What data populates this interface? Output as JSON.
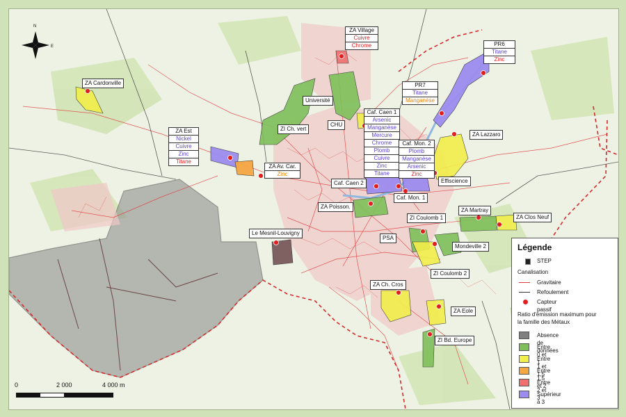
{
  "scale": {
    "t0": "0",
    "t1": "2 000",
    "t2": "4 000 m"
  },
  "compass": {
    "n": "N",
    "e": "E"
  },
  "labels": {
    "za_cardonville": "ZA Cardonville",
    "universite": "Université",
    "zi_ch_vert": "ZI Ch. vert",
    "chu": "CHU",
    "za_lazzaro": "ZA Lazzaro",
    "effiscience": "Effiscience",
    "caf_caen2": "Caf. Caen 2",
    "caf_mon1": "Caf. Mon. 1",
    "za_poisson": "ZA Poisson.",
    "za_martray": "ZA Martray",
    "za_clos_neuf": "ZA Clos Neuf",
    "zi_coulomb1": "ZI Coulomb 1",
    "psa": "PSA",
    "mondeville2": "Mondeville 2",
    "le_mesnil": "Le Mesnil-Louvigny",
    "zi_coulomb2": "ZI Coulomb 2",
    "za_ch_cros": "ZA Ch. Cros",
    "za_eole": "ZA Eole",
    "zi_bd_europe": "ZI Bd. Europe"
  },
  "boxes": {
    "za_village": {
      "title": "ZA Village",
      "items": [
        {
          "t": "Cuivre",
          "c": "r"
        },
        {
          "t": "Chrome",
          "c": "r"
        }
      ]
    },
    "pr6": {
      "title": "PR6",
      "items": [
        {
          "t": "Titane",
          "c": "p"
        },
        {
          "t": "Zinc",
          "c": "r"
        }
      ]
    },
    "pr7": {
      "title": "PR7",
      "items": [
        {
          "t": "Titane",
          "c": "p"
        },
        {
          "t": "Manganèse",
          "c": "o"
        }
      ]
    },
    "caf_caen1": {
      "title": "Caf. Caen 1",
      "items": [
        {
          "t": "Arsenic",
          "c": "p"
        },
        {
          "t": "Manganèse",
          "c": "p"
        },
        {
          "t": "Mercure",
          "c": "p"
        },
        {
          "t": "Chrome",
          "c": "p"
        },
        {
          "t": "Plomb",
          "c": "p"
        },
        {
          "t": "Cuivre",
          "c": "p"
        },
        {
          "t": "Zinc",
          "c": "p"
        },
        {
          "t": "Titane",
          "c": "p"
        }
      ]
    },
    "caf_mon2": {
      "title": "Caf. Mon. 2",
      "items": [
        {
          "t": "Plomb",
          "c": "p"
        },
        {
          "t": "Manganèse",
          "c": "p"
        },
        {
          "t": "Arsenic",
          "c": "p"
        },
        {
          "t": "Zinc",
          "c": "r"
        }
      ]
    },
    "za_est": {
      "title": "ZA Est",
      "items": [
        {
          "t": "Nickel",
          "c": "p"
        },
        {
          "t": "Cuivre",
          "c": "p"
        },
        {
          "t": "Zinc",
          "c": "p"
        },
        {
          "t": "Titane",
          "c": "r"
        }
      ]
    },
    "za_av_car": {
      "title": "ZA Av. Car.",
      "items": [
        {
          "t": "Zinc",
          "c": "o"
        }
      ]
    }
  },
  "legend": {
    "title": "Légende",
    "step": "STEP",
    "canalisation": "Canalisation",
    "gravitaire": "Gravitaire",
    "refoulement": "Refoulement",
    "capteur": "Capteur passif",
    "ratio_l1": "Ratio d'émission maximum pour",
    "ratio_l2": "la famille des Métaux",
    "classes": [
      {
        "label": "Absence de données",
        "color": "#808080"
      },
      {
        "label": "Entre 0 et 1",
        "color": "#7fbf5a"
      },
      {
        "label": "Entre 1 et 1,5",
        "color": "#f2ee4a"
      },
      {
        "label": "Entre 1,5 et 2",
        "color": "#f5a742"
      },
      {
        "label": "Entre 2 et 3",
        "color": "#f07070"
      },
      {
        "label": "Supérieur à 3",
        "color": "#9d8cf0"
      }
    ]
  },
  "colors": {
    "purple": "#5a3fd6",
    "red": "#e02020",
    "orange": "#f08000",
    "network": "#e03a3a",
    "boundary": "#d42a2a"
  }
}
